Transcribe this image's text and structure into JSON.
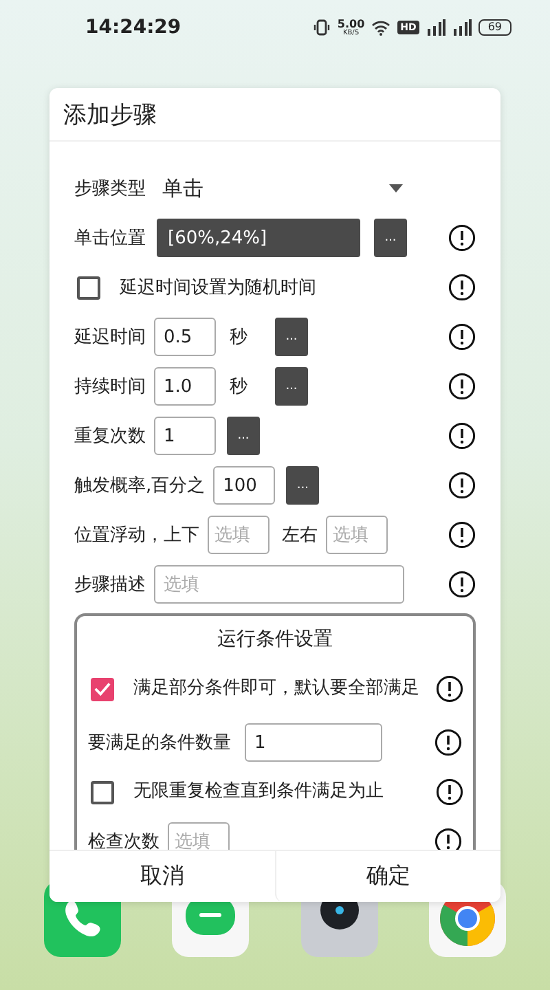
{
  "status_bar": {
    "time": "14:24:29",
    "speed": "5.00",
    "speed_unit": "KB/S",
    "hd": "HD",
    "battery": "69"
  },
  "dialog": {
    "title": "添加步骤",
    "rows": [
      {
        "kind": "select",
        "label": "步骤类型",
        "value": "单击"
      },
      {
        "kind": "position",
        "label": "单击位置",
        "value": "[60%,24%]",
        "button": "..."
      },
      {
        "kind": "checkbox",
        "label": "延迟时间设置为随机时间",
        "checked": false
      },
      {
        "kind": "number",
        "label": "延迟时间",
        "value": "0.5",
        "unit": "秒",
        "button": "..."
      },
      {
        "kind": "number",
        "label": "持续时间",
        "value": "1.0",
        "unit": "秒",
        "button": "..."
      },
      {
        "kind": "number",
        "label": "重复次数",
        "value": "1",
        "button": "..."
      },
      {
        "kind": "number",
        "label": "触发概率,百分之",
        "value": "100",
        "button": "..."
      },
      {
        "kind": "float",
        "label": "位置浮动，上下",
        "placeholder": "选填",
        "label2": "左右",
        "placeholder2": "选填"
      },
      {
        "kind": "text",
        "label": "步骤描述",
        "placeholder": "选填"
      }
    ],
    "conditions": {
      "title": "运行条件设置",
      "rows": [
        {
          "kind": "checkbox",
          "label": "满足部分条件即可，默认要全部满足",
          "checked": true
        },
        {
          "kind": "count",
          "label": "要满足的条件数量",
          "value": "1"
        },
        {
          "kind": "checkbox",
          "label": "无限重复检查直到条件满足为止",
          "checked": false
        },
        {
          "kind": "short",
          "label": "检查次数",
          "placeholder": "选填"
        }
      ]
    },
    "buttons": [
      "取消",
      "确定"
    ]
  }
}
